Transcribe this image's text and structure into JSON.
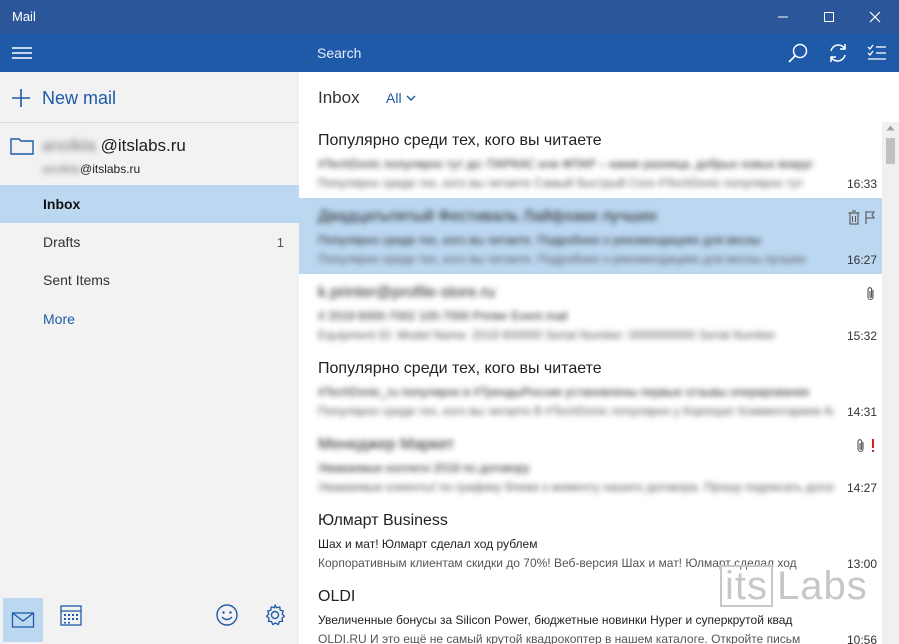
{
  "window": {
    "title": "Mail"
  },
  "sidebar": {
    "new_mail_label": "New mail",
    "account": {
      "name_blurred": "anolkla",
      "domain": "@itslabs.ru",
      "email_blurred": "anolkla",
      "email_domain": "@itslabs.ru"
    },
    "folders": [
      {
        "label": "Inbox",
        "count": "",
        "selected": true
      },
      {
        "label": "Drafts",
        "count": "1",
        "selected": false
      },
      {
        "label": "Sent Items",
        "count": "",
        "selected": false
      },
      {
        "label": "More",
        "count": "",
        "selected": false
      }
    ],
    "bottom_icons": [
      "mail-icon",
      "calendar-icon",
      "smiley-icon",
      "settings-icon"
    ]
  },
  "search": {
    "placeholder": "Search"
  },
  "list_header": {
    "folder": "Inbox",
    "filter": "All"
  },
  "messages": [
    {
      "sender": "Популярно среди тех, кого вы читаете",
      "subject": "#TechDonic популярно тут до: ПАРКАС или ФПАР – какие разница, добрых новых вокруг",
      "preview": "Популярно среди тех, кого вы читаете Самый быстрый Core #TechDonic популярно тут",
      "time": "16:33",
      "blurred": {
        "subject": true,
        "preview": true
      },
      "selected": false,
      "icons": []
    },
    {
      "sender": "Двадцатьпятый Фестиваль Лайфхаки лучших",
      "subject": "Популярно среди тех, кого вы читаете. Подробнее о рекомендациях для весны",
      "preview": "Популярно среди тех, кого вы читаете. Подробнее о рекомендациях для весны лучших",
      "time": "16:27",
      "blurred": {
        "sender": true,
        "subject": true,
        "preview": true
      },
      "selected": true,
      "icons": [
        "delete-icon",
        "flag-icon"
      ]
    },
    {
      "sender": "k.printer@profile-store.ru",
      "subject": "# 2019 6000-7002 100-7000 Printer Event mail",
      "preview": "Equipment ID: Model Name: 2019 600000 Serial Number: 0000000000 Serial Number",
      "time": "15:32",
      "blurred": {
        "sender": true,
        "subject": true,
        "preview": true
      },
      "selected": false,
      "icons": [
        "attachment-icon"
      ]
    },
    {
      "sender": "Популярно среди тех, кого вы читаете",
      "subject": "#TechDonic_ru популярно в #ТрендыРоссии установлены первые отзывы оперирование",
      "preview": "Популярно среди тех, кого вы читаете В #TechDonic популярно у Корпорат Комментариев Аррхив",
      "time": "14:31",
      "blurred": {
        "subject": true,
        "preview": true
      },
      "selected": false,
      "icons": []
    },
    {
      "sender": "Менеджер Маркет",
      "subject": "Уважаемые коллеги 2018 по договору",
      "preview": "Уважаемые клиенты! по графику ближе к моменту нашего договора. Прошу подписать договор",
      "time": "14:27",
      "blurred": {
        "sender": true,
        "subject": true,
        "preview": true
      },
      "selected": false,
      "icons": [
        "attachment-icon",
        "importance-icon"
      ]
    },
    {
      "sender": "Юлмарт Business",
      "subject": "Шах и мат! Юлмарт сделал ход рублем",
      "preview": "Корпоративным клиентам скидки до 70%! Веб-версия Шах и мат! Юлмарт сделал ход",
      "time": "13:00",
      "blurred": {},
      "selected": false,
      "icons": []
    },
    {
      "sender": "OLDI",
      "subject": "Увеличенные бонусы за Silicon Power, бюджетные новинки Hyper и суперкрутой квад",
      "preview": "OLDI.RU И это ещё не самый крутой квадрокоптер в нашем каталоге. Откройте письм",
      "time": "10:56",
      "blurred": {},
      "selected": false,
      "icons": []
    }
  ],
  "watermark": {
    "part1": "its",
    "part2": "Labs"
  }
}
